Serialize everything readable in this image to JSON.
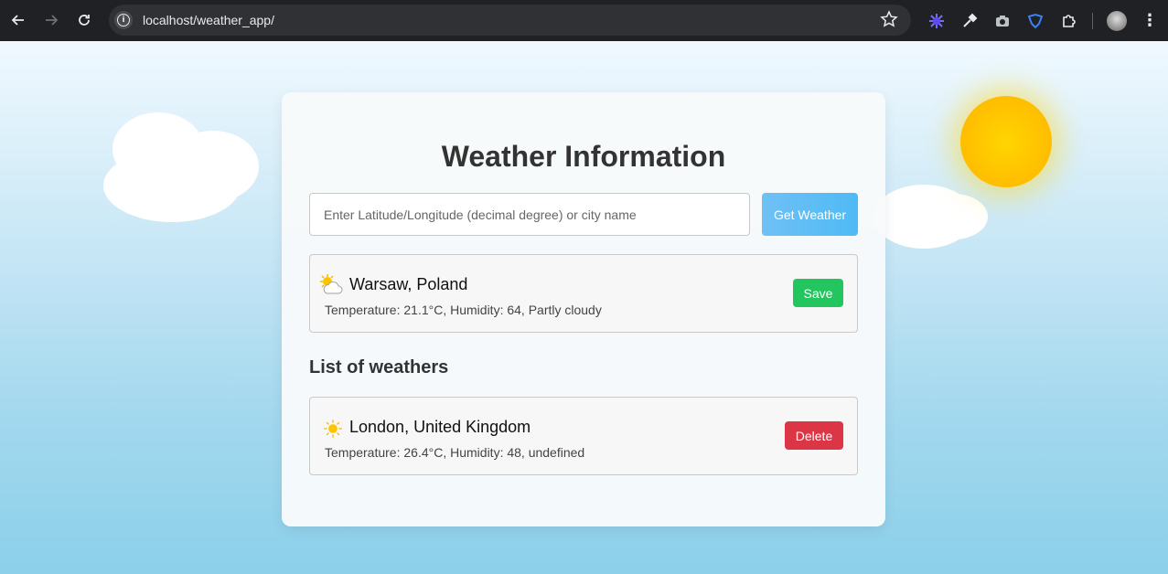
{
  "browser": {
    "url": "localhost/weather_app/",
    "icons": {
      "back": "arrow-left-icon",
      "forward": "arrow-right-icon",
      "reload": "reload-icon",
      "site_info": "info-icon",
      "bookmark": "star-icon",
      "menu": "kebab-menu-icon"
    }
  },
  "page": {
    "title": "Weather Information",
    "search": {
      "placeholder": "Enter Latitude/Longitude (decimal degree) or city name",
      "value": ""
    },
    "get_weather_label": "Get Weather",
    "current": {
      "city": "Warsaw, Poland",
      "details": "Temperature: 21.1°C, Humidity: 64, Partly cloudy",
      "icon": "partly-cloudy-icon",
      "save_label": "Save"
    },
    "list_heading": "List of weathers",
    "saved": [
      {
        "city": "London, United Kingdom",
        "details": "Temperature: 26.4°C, Humidity: 48, undefined",
        "icon": "sun-icon",
        "delete_label": "Delete"
      }
    ]
  },
  "colors": {
    "get_weather_button": "#5bbdf5",
    "save_button": "#22c55e",
    "delete_button": "#dc3545",
    "sun": "#ffc400"
  }
}
